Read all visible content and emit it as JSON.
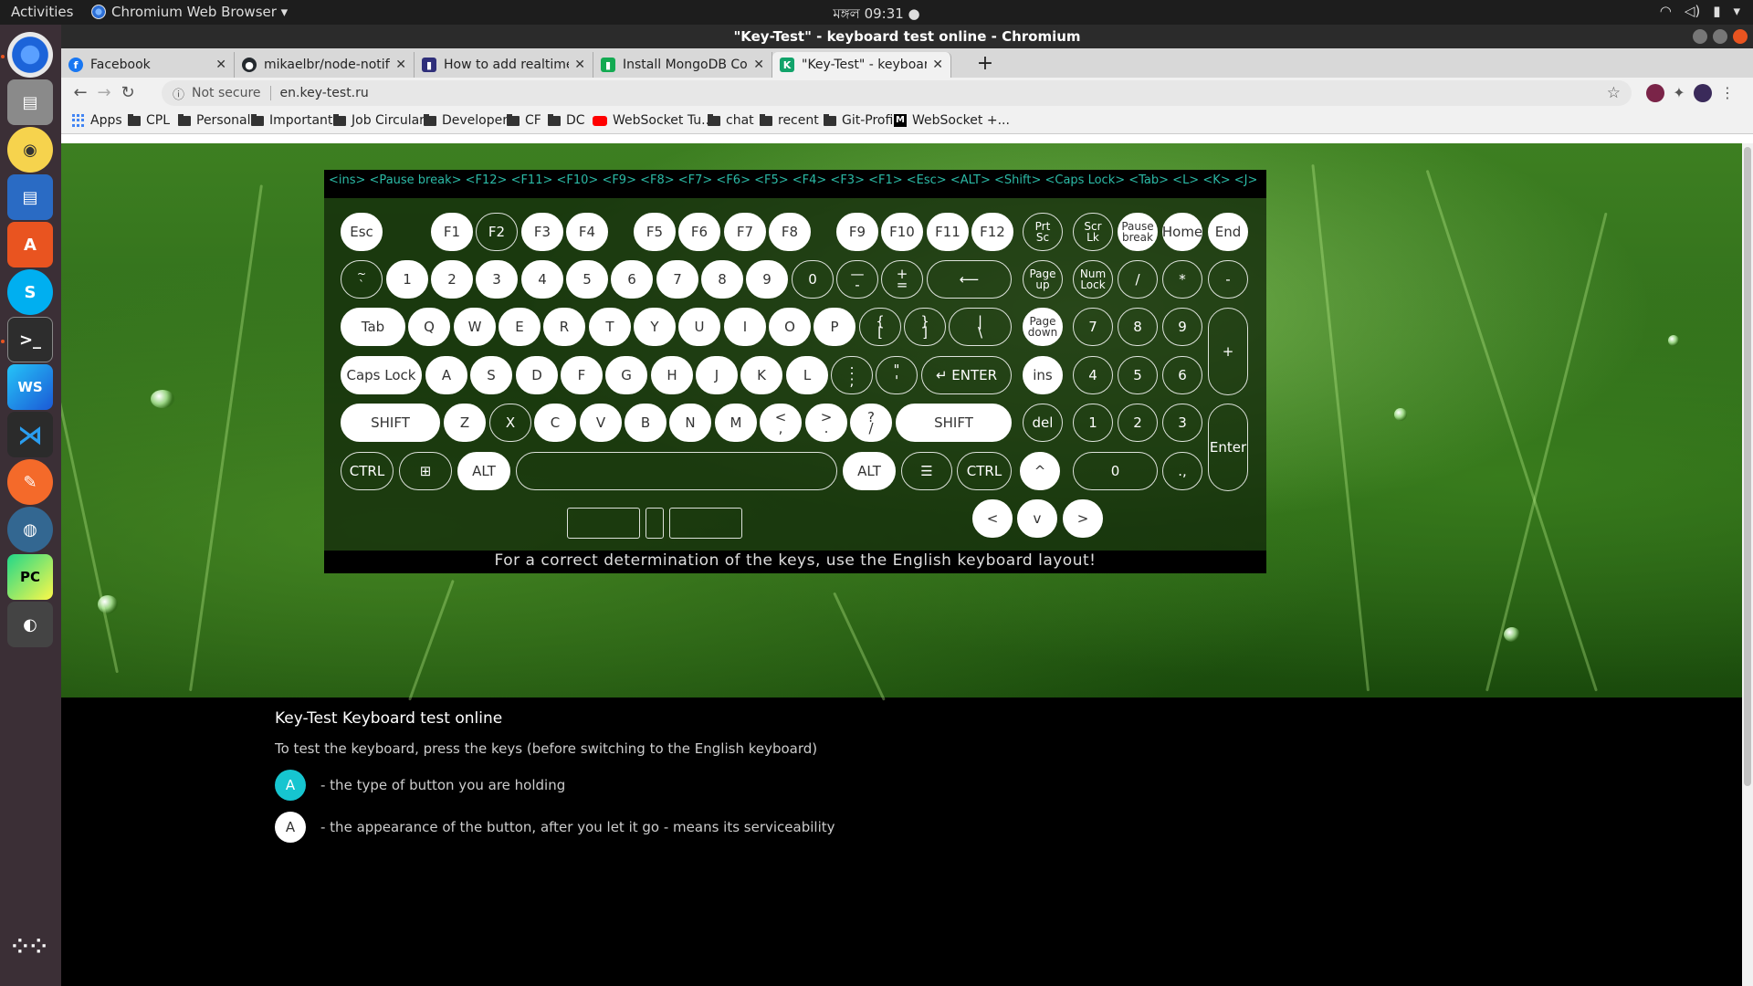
{
  "topbar": {
    "activities": "Activities",
    "app_name": "Chromium Web Browser ▾",
    "clock": "মঙ্গল 09:31 ●"
  },
  "window": {
    "title": "\"Key-Test\" - keyboard test online - Chromium"
  },
  "tabs": [
    {
      "title": "Facebook",
      "icon_color": "#1877f2",
      "icon_glyph": "f"
    },
    {
      "title": "mikaelbr/node-notifier: A",
      "icon_color": "#24292e",
      "icon_glyph": "●"
    },
    {
      "title": "How to add realtime notif",
      "icon_color": "#2f2f7a",
      "icon_glyph": "▮"
    },
    {
      "title": "Install MongoDB Commu",
      "icon_color": "#13aa52",
      "icon_glyph": "▮"
    },
    {
      "title": "\"Key-Test\" - keyboard test",
      "icon_color": "#11a36a",
      "icon_glyph": "K",
      "active": true
    }
  ],
  "address": {
    "security": "Not secure",
    "url": "en.key-test.ru"
  },
  "bookmarks": {
    "apps": "Apps",
    "items": [
      "CPL",
      "Personal",
      "Important",
      "Job Circular",
      "Developer",
      "CF",
      "DC",
      "WebSocket Tu...",
      "chat",
      "recent",
      "Git-Profile",
      "WebSocket +..."
    ]
  },
  "keyboard": {
    "log": "<ins>   <Pause break>   <F12>   <F11>   <F10>   <F9>   <F8>   <F7>   <F6>   <F5>   <F4>   <F3>   <F1>   <Esc>   <ALT>   <Shift>   <Caps Lock>   <Tab>   <L>   <K>   <J>",
    "note": "For a correct determination of the keys, use the English keyboard layout!",
    "keys": {
      "esc": "Esc",
      "f1": "F1",
      "f2": "F2",
      "f3": "F3",
      "f4": "F4",
      "f5": "F5",
      "f6": "F6",
      "f7": "F7",
      "f8": "F8",
      "f9": "F9",
      "f10": "F10",
      "f11": "F11",
      "f12": "F12",
      "prtsc": "Prt\nSc",
      "scrlk": "Scr\nLk",
      "pause": "Pause\nbreak",
      "home": "Home",
      "end": "End",
      "tilde": "~\n`",
      "d1": "1",
      "d2": "2",
      "d3": "3",
      "d4": "4",
      "d5": "5",
      "d6": "6",
      "d7": "7",
      "d8": "8",
      "d9": "9",
      "d0": "0",
      "minus": "—\n-",
      "plus": "+\n=",
      "backspace": "⟵",
      "pgup": "Page\nup",
      "numlock": "Num\nLock",
      "npdiv": "/",
      "npmul": "*",
      "npsub": "-",
      "tab": "Tab",
      "q": "Q",
      "w": "W",
      "e": "E",
      "r": "R",
      "t": "T",
      "y": "Y",
      "u": "U",
      "i": "I",
      "o": "O",
      "p": "P",
      "lbrace": "{\n[",
      "rbrace": "}\n]",
      "bslash": "|\n\\",
      "pgdn": "Page\ndown",
      "np7": "7",
      "np8": "8",
      "np9": "9",
      "npadd": "+",
      "caps": "Caps Lock",
      "a": "A",
      "s": "S",
      "d": "D",
      "f": "F",
      "g": "G",
      "h": "H",
      "j": "J",
      "k": "K",
      "l": "L",
      "semi": ":\n;",
      "quote": "\"\n'",
      "enter": "↵ ENTER",
      "ins": "ins",
      "np4": "4",
      "np5": "5",
      "np6": "6",
      "lshift": "SHIFT",
      "z": "Z",
      "x": "X",
      "c": "C",
      "v": "V",
      "b": "B",
      "n": "N",
      "m": "M",
      "comma": "<\n,",
      "period": ">\n.",
      "slash": "?\n/",
      "rshift": "SHIFT",
      "del": "del",
      "np1": "1",
      "np2": "2",
      "np3": "3",
      "npenter": "Enter",
      "lctrl": "CTRL",
      "win": "⊞",
      "lalt": "ALT",
      "space": "",
      "ralt": "ALT",
      "menu": "☰",
      "rctrl": "CTRL",
      "up": "^",
      "np0": "0",
      "npdot": ".,",
      "left": "<",
      "down": "v",
      "right": ">"
    }
  },
  "info": {
    "heading": "Key-Test Keyboard test online",
    "instruction": "To test the keyboard, press the keys (before switching to the English keyboard)",
    "legend": [
      {
        "key": "A",
        "text": "- the type of button you are holding",
        "color": "#16c5d0"
      },
      {
        "key": "A",
        "text": "- the appearance of the button, after you let it go - means its serviceability",
        "color": "#ffffff"
      }
    ]
  }
}
